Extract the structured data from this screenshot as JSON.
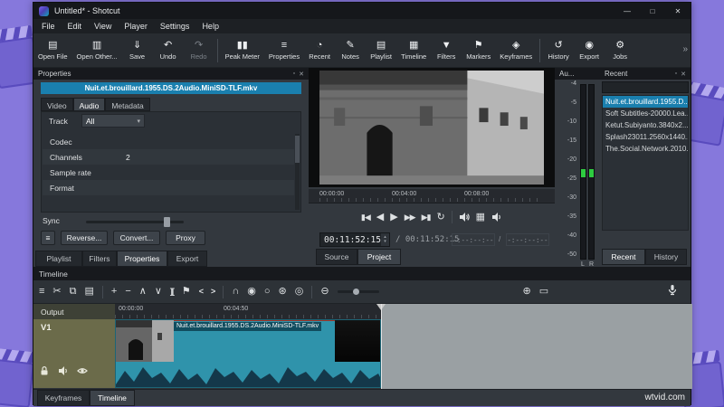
{
  "window": {
    "title": "Untitled* - Shotcut",
    "controls": {
      "minimize": "—",
      "maximize": "□",
      "close": "✕"
    }
  },
  "menubar": {
    "items": [
      "File",
      "Edit",
      "View",
      "Player",
      "Settings",
      "Help"
    ]
  },
  "toolbar": {
    "items": [
      {
        "name": "open-file",
        "icon": "▤",
        "label": "Open File"
      },
      {
        "name": "open-other",
        "icon": "▥",
        "label": "Open Other..."
      },
      {
        "name": "save",
        "icon": "⇓",
        "label": "Save"
      },
      {
        "name": "undo",
        "icon": "↶",
        "label": "Undo"
      },
      {
        "name": "redo",
        "icon": "↷",
        "label": "Redo",
        "disabled": true
      },
      {
        "name": "peak-meter",
        "icon": "▮▮",
        "label": "Peak Meter"
      },
      {
        "name": "properties",
        "icon": "≡",
        "label": "Properties"
      },
      {
        "name": "recent",
        "icon": "◔",
        "label": "Recent"
      },
      {
        "name": "notes",
        "icon": "✎",
        "label": "Notes"
      },
      {
        "name": "playlist",
        "icon": "▤",
        "label": "Playlist"
      },
      {
        "name": "timeline",
        "icon": "▦",
        "label": "Timeline"
      },
      {
        "name": "filters",
        "icon": "▼",
        "label": "Filters"
      },
      {
        "name": "markers",
        "icon": "⚑",
        "label": "Markers"
      },
      {
        "name": "keyframes",
        "icon": "◈",
        "label": "Keyframes"
      },
      {
        "name": "history",
        "icon": "↺",
        "label": "History"
      },
      {
        "name": "export",
        "icon": "◉",
        "label": "Export"
      },
      {
        "name": "jobs",
        "icon": "⚙",
        "label": "Jobs"
      }
    ],
    "overflow": "»"
  },
  "properties": {
    "dock_title": "Properties",
    "float_icon": "▫",
    "close_icon": "✕",
    "filename": "Nuit.et.brouillard.1955.DS.2Audio.MiniSD-TLF.mkv",
    "tabs": [
      "Video",
      "Audio",
      "Metadata"
    ],
    "active_tab": "Audio",
    "track_label": "Track",
    "track_value": "All",
    "dropdown_arrow": "▾",
    "rows": [
      {
        "label": "Codec",
        "value": ""
      },
      {
        "label": "Channels",
        "value": "2"
      },
      {
        "label": "Sample rate",
        "value": ""
      },
      {
        "label": "Format",
        "value": ""
      }
    ],
    "sync_label": "Sync",
    "menu_icon": "≡",
    "buttons": [
      "Reverse...",
      "Convert...",
      "Proxy"
    ],
    "dock_tabs": [
      "Playlist",
      "Filters",
      "Properties",
      "Export"
    ],
    "active_dock_tab": "Properties"
  },
  "player": {
    "scrubber_labels": [
      "00:00:00",
      "00:04:00",
      "00:08:00"
    ],
    "transport": {
      "skip_start": "▮◀",
      "step_backward": "◀",
      "play": "▶",
      "fast_forward": "▶▶",
      "skip_end": "▶▮",
      "loop": "↻",
      "grid": "▦"
    },
    "spin_up": "▴",
    "spin_down": "▾",
    "current_time": "00:11:52:15",
    "duration_separator": "/",
    "duration": "00:11:52:15",
    "selected_in": "-:--:--:--",
    "selected_separator": "/",
    "selected_out": "-:--:--:--",
    "tabs": [
      "Source",
      "Project"
    ],
    "active_tab": "Project"
  },
  "audio_meter": {
    "dock_title": "Au...",
    "scale": [
      "-4",
      "-5",
      "-10",
      "-15",
      "-20",
      "-25",
      "-30",
      "-35",
      "-40",
      "-50"
    ],
    "channel_left": "L",
    "channel_right": "R"
  },
  "recent": {
    "dock_title": "Recent",
    "float_icon": "▫",
    "close_icon": "✕",
    "search_value": "",
    "items": [
      "Nuit.et.brouillard.1955.D...",
      "Soft Subtitles-20000.Lea...",
      "Ketut.Subiyanto.3840x2...",
      "Splash23011.2560x1440...",
      "The.Social.Network.2010..."
    ],
    "selected_item": "Nuit.et.brouillard.1955.D...",
    "dock_tabs": [
      "Recent",
      "History"
    ],
    "active_dock_tab": "Recent"
  },
  "timeline": {
    "dock_title": "Timeline",
    "tools": {
      "menu": "≡",
      "cut": "✂",
      "copy": "⧉",
      "paste": "▤",
      "append": "+",
      "ripple_delete": "−",
      "lift": "∧",
      "overwrite": "∨",
      "split": "][",
      "marker": "⚑",
      "prev_marker": "<",
      "next_marker": ">",
      "snap": "∩",
      "scrub": "◉",
      "ripple": "○",
      "ripple_all": "⊛",
      "ripple_markers": "◎",
      "zoom_out": "⊖",
      "zoom_in": "⊕",
      "zoom_fit": "▭"
    },
    "ruler_labels": [
      "00:00:00",
      "00:04:50"
    ],
    "output_label": "Output",
    "track_label": "V1",
    "clip_label": "Nuit.et.brouillard.1955.DS.2Audio.MiniSD-TLF.mkv",
    "dock_tabs": [
      "Keyframes",
      "Timeline"
    ],
    "active_dock_tab": "Timeline"
  },
  "watermark": "wtvid.com",
  "colors": {
    "accent": "#1a7fae",
    "clip": "#2f93ab",
    "track_header": "#6b6b4a",
    "meter_green": "#2ecc40",
    "frame": "#8678dc"
  }
}
